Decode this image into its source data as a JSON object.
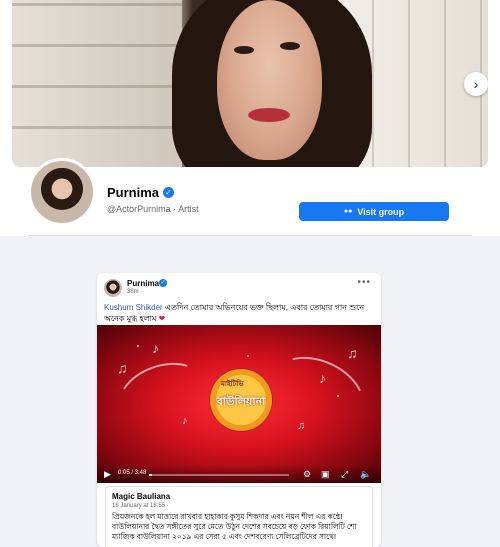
{
  "profile": {
    "name": "Purnima",
    "handle_category": "@ActorPurnima · Artist",
    "visit_button": "Visit group"
  },
  "post": {
    "author": "Purnima",
    "time": "38m ·",
    "more": "•••",
    "text": {
      "mention": "Kushum Shikder",
      "body": " এতদিন তোমার অভিনয়ের ভক্ত ছিলাম, এবার তোমার গান শুনে অনেক মুগ্ধ হলাম",
      "emoji": "❤"
    },
    "video": {
      "logo_top": "মাইটিভি",
      "logo_main": "বাউলিয়ানা",
      "time": "0:05 / 3:48",
      "progress": 0.02
    },
    "link": {
      "title": "Magic Bauliana",
      "date": "18 January at 18:55 ·",
      "body": "প্রিয়জনকে হল মাত্তারে রাখবার হাহাকার কুসুম শিকদার এবং নয়ন শীল এর কন্ঠে! বাউলিয়ানার দ্বৈত সঙ্গীতের সুরে মেতে উঠুন দেশের সবচেয়ে বড় ফোক রিয়ালিটি শো ম্যাজিক বাউলিয়ানা ২০১৯ এর সেরা ৫ এবং দেশবরেণ্য সেলিব্রেটিদের সাথে!"
    }
  },
  "icons": {
    "next": "›",
    "verified": "✓",
    "group": "👥",
    "play": "▶",
    "settings": "⚙",
    "pip": "▣",
    "fullscreen": "⤢",
    "volume": "🔈"
  },
  "colors": {
    "accent": "#1877f2",
    "video_red": "#d6121e"
  }
}
